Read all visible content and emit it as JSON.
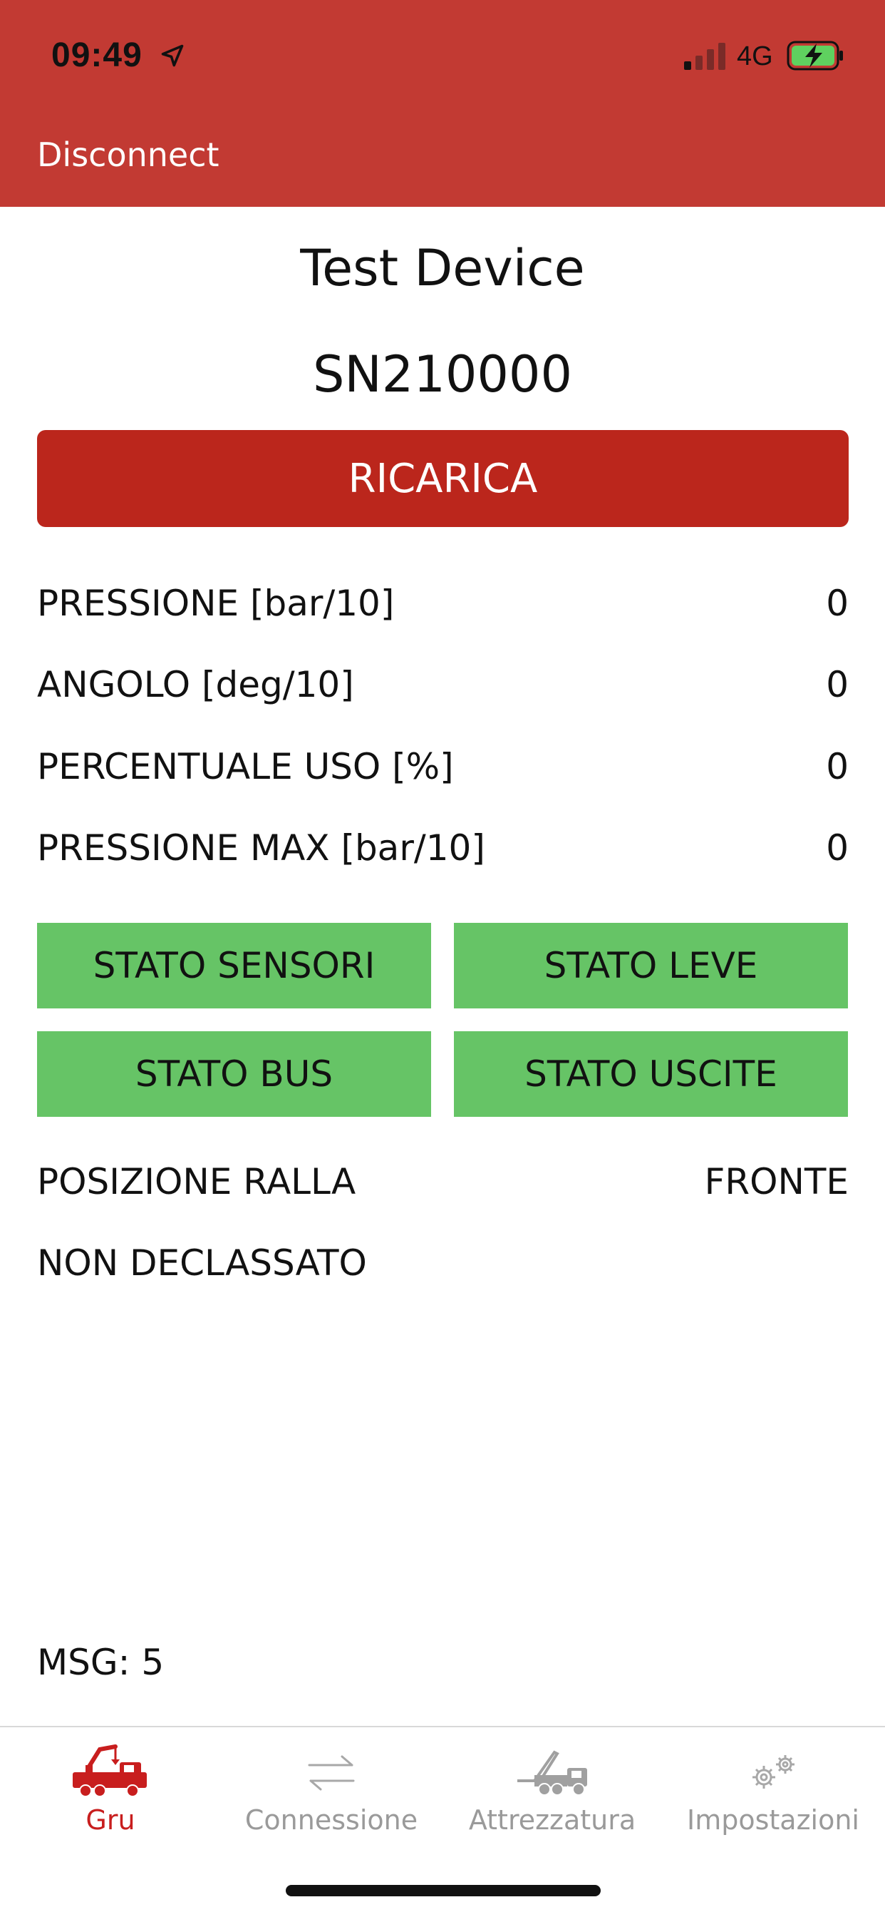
{
  "status_bar": {
    "time": "09:49",
    "network": "4G",
    "icons": [
      "location-arrow-icon",
      "cellular-signal-icon",
      "battery-charging-icon"
    ]
  },
  "nav": {
    "disconnect_label": "Disconnect",
    "accent_color": "#c23a33"
  },
  "device": {
    "name": "Test Device",
    "serial": "SN210000"
  },
  "recharge": {
    "label": "RICARICA",
    "color": "#bb261c"
  },
  "readings": [
    {
      "label": "PRESSIONE [bar/10]",
      "value": "0"
    },
    {
      "label": "ANGOLO [deg/10]",
      "value": "0"
    },
    {
      "label": "PERCENTUALE USO [%]",
      "value": "0"
    },
    {
      "label": "PRESSIONE MAX [bar/10]",
      "value": "0"
    }
  ],
  "status_buttons": {
    "color": "#66c466",
    "sensors": "STATO SENSORI",
    "levers": "STATO LEVE",
    "bus": "STATO BUS",
    "outputs": "STATO USCITE"
  },
  "fifth_wheel": {
    "label": "POSIZIONE RALLA",
    "value": "FRONTE"
  },
  "downgrade_status": "NON DECLASSATO",
  "msg": "MSG: 5",
  "tabs": [
    {
      "label": "Gru",
      "icon": "crane-truck-icon",
      "active": true
    },
    {
      "label": "Connessione",
      "icon": "transfer-arrows-icon",
      "active": false
    },
    {
      "label": "Attrezzatura",
      "icon": "hook-truck-icon",
      "active": false
    },
    {
      "label": "Impostazioni",
      "icon": "gears-icon",
      "active": false
    }
  ],
  "tab_colors": {
    "active": "#c81e1e",
    "inactive": "#9a9a9a"
  }
}
